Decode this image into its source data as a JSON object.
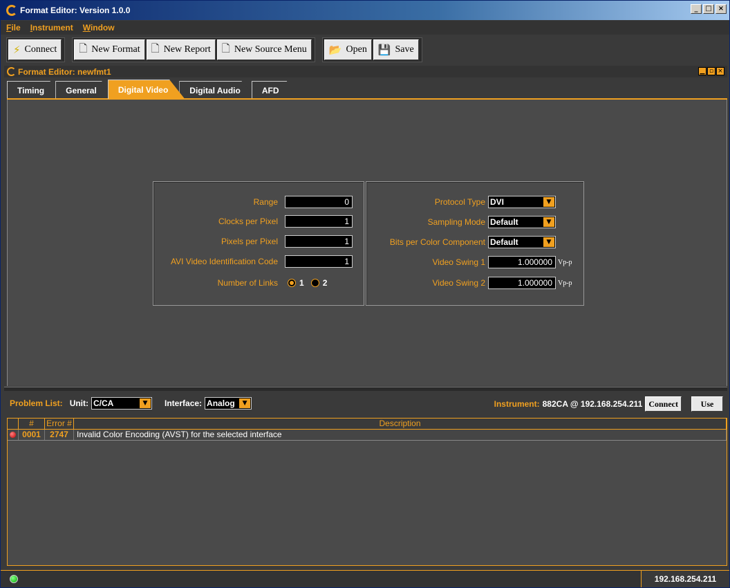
{
  "window": {
    "title": "Format Editor: Version 1.0.0",
    "min": "_",
    "max": "□",
    "close": "×"
  },
  "menu": [
    "File",
    "Instrument",
    "Window"
  ],
  "toolbar": {
    "connect": "Connect",
    "new_format": "New Format",
    "new_report": "New Report",
    "new_source_menu": "New Source Menu",
    "open": "Open",
    "save": "Save"
  },
  "editor": {
    "title": "Format Editor: newfmt1"
  },
  "tabs": [
    "Timing",
    "General",
    "Digital Video",
    "Digital Audio",
    "AFD"
  ],
  "active_tab": "Digital Video",
  "left_panel": {
    "range": {
      "label": "Range",
      "value": "0"
    },
    "clocks": {
      "label": "Clocks per Pixel",
      "value": "1"
    },
    "pixels": {
      "label": "Pixels per Pixel",
      "value": "1"
    },
    "avi": {
      "label": "AVI Video Identification Code",
      "value": "1"
    },
    "links": {
      "label": "Number of Links",
      "opt1": "1",
      "opt2": "2",
      "selected": "1"
    }
  },
  "right_panel": {
    "protocol": {
      "label": "Protocol Type",
      "value": "DVI"
    },
    "sampling": {
      "label": "Sampling Mode",
      "value": "Default"
    },
    "bits": {
      "label": "Bits per Color Component",
      "value": "Default"
    },
    "swing1": {
      "label": "Video Swing 1",
      "value": "1.000000",
      "unit": "Vp-p"
    },
    "swing2": {
      "label": "Video Swing 2",
      "value": "1.000000",
      "unit": "Vp-p"
    }
  },
  "problems": {
    "label": "Problem List:",
    "unit_label": "Unit:",
    "unit_value": "C/CA",
    "interface_label": "Interface:",
    "interface_value": "Analog",
    "instrument_label": "Instrument:",
    "instrument_value": "882CA @ 192.168.254.211",
    "connect": "Connect",
    "use": "Use",
    "columns": [
      "#",
      "Error #",
      "Description"
    ],
    "rows": [
      {
        "num": "0001",
        "error": "2747",
        "description": "Invalid Color Encoding (AVST) for the selected interface"
      }
    ]
  },
  "status": {
    "ip": "192.168.254.211"
  },
  "colors": {
    "accent": "#f0a020",
    "background": "#4a4a4a"
  }
}
